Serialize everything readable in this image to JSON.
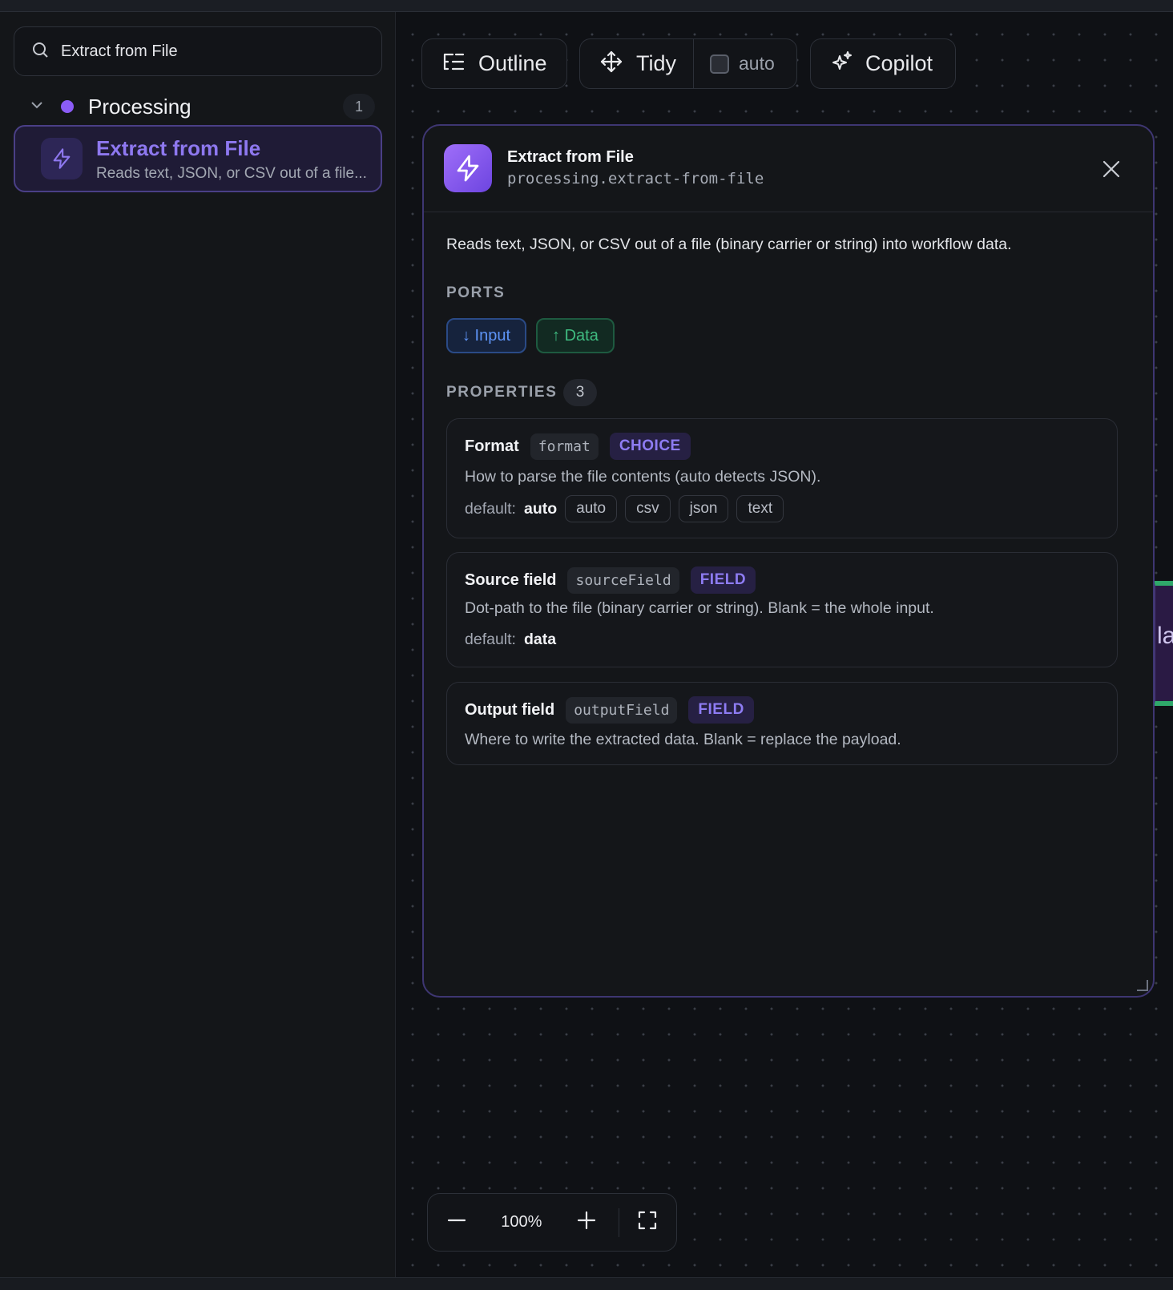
{
  "sidebar": {
    "search": {
      "value": "Extract from File",
      "placeholder": ""
    },
    "group": {
      "name": "Processing",
      "count": "1",
      "dot_color": "#8b5cf6"
    },
    "item": {
      "title": "Extract from File",
      "description": "Reads text, JSON, or CSV out of a file..."
    }
  },
  "toolbar": {
    "outline_label": "Outline",
    "tidy_label": "Tidy",
    "auto_label": "auto",
    "auto_checked": false,
    "copilot_label": "Copilot"
  },
  "panel": {
    "title": "Extract from File",
    "id": "processing.extract-from-file",
    "description": "Reads text, JSON, or CSV out of a file (binary carrier or string) into workflow data.",
    "ports_label": "PORTS",
    "ports": {
      "input": "↓ Input",
      "output": "↑ Data"
    },
    "properties_label": "PROPERTIES",
    "properties_count": "3",
    "properties": [
      {
        "name": "Format",
        "key": "format",
        "type": "CHOICE",
        "description": "How to parse the file contents (auto detects JSON).",
        "default_label": "default:",
        "default_value": "auto",
        "options": [
          "auto",
          "csv",
          "json",
          "text"
        ]
      },
      {
        "name": "Source field",
        "key": "sourceField",
        "type": "FIELD",
        "description": "Dot-path to the file (binary carrier or string). Blank = the whole input.",
        "default_label": "default:",
        "default_value": "data"
      },
      {
        "name": "Output field",
        "key": "outputField",
        "type": "FIELD",
        "description": "Where to write the extracted data. Blank = replace the payload."
      }
    ]
  },
  "canvas": {
    "offscreen_node_text": "la"
  },
  "zoom": {
    "value": "100%"
  },
  "colors": {
    "accent": "#8b5cf6",
    "port_input": "#5d93f5",
    "port_output": "#3fbb80"
  },
  "icons": [
    "search-icon",
    "chevron-down-icon",
    "bolt-icon",
    "outline-icon",
    "move-icon",
    "sparkles-icon",
    "close-icon",
    "minus-icon",
    "plus-icon",
    "fullscreen-icon"
  ]
}
